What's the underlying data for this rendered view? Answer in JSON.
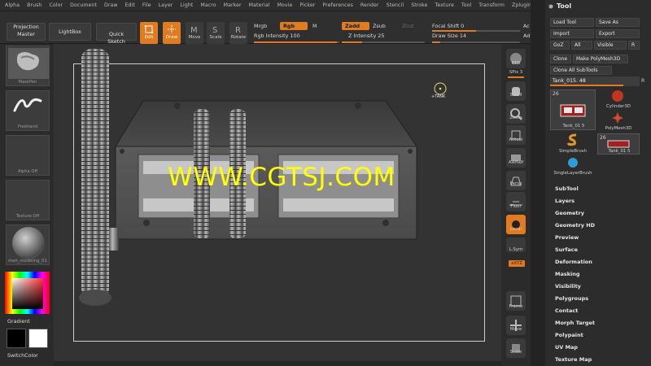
{
  "menu": [
    "Alpha",
    "Brush",
    "Color",
    "Document",
    "Draw",
    "Edit",
    "File",
    "Layer",
    "Light",
    "Macro",
    "Marker",
    "Material",
    "Movie",
    "Picker",
    "Preferences",
    "Render",
    "Stencil",
    "Stroke",
    "Texture",
    "Tool",
    "Transform",
    "Zplugin",
    "Zscript"
  ],
  "toolbar": {
    "projection_master": "Projection\nMaster",
    "lightbox": "LightBox",
    "quick_sketch": "Quick\nSketch",
    "edit": "Edit",
    "draw": "Draw",
    "move": "Move",
    "scale": "Scale",
    "rotate": "Rotate",
    "mrgb": "Mrgb",
    "rgb": "Rgb",
    "m": "M",
    "zadd": "Zadd",
    "zsub": "Zsub",
    "zcut": "Zcut",
    "rgb_intensity": "Rgb Intensity 100",
    "z_intensity": "Z Intensity 25",
    "focal_shift": "Focal Shift 0",
    "draw_size": "Draw Size 14",
    "ac": "Ac",
    "ad": "Ad"
  },
  "left": {
    "brush_label": "MaskPen",
    "stroke_label": "Freehand",
    "alpha_label": "Alpha Off",
    "texture_label": "Texture Off",
    "material_label": "mah_modeling_01",
    "gradient": "Gradient",
    "switchcolor": "SwitchColor"
  },
  "canvas": {
    "watermark": "WWW.CGTSJ.COM",
    "cursor_label": "+TANK"
  },
  "right": {
    "bpr": "BPR",
    "spix": "SPix 3",
    "scroll": "Scroll",
    "zoom": "Zoom",
    "actual": "Actual",
    "aahalf": "AAHalf",
    "persp": "Persp",
    "floor": "Floor",
    "local": "Local",
    "lsym": "L.Sym",
    "xyz": "xXYZ",
    "frame": "Frame",
    "move": "Move",
    "scale": "Scale"
  },
  "palette": {
    "title": "Tool",
    "load_tool": "Load Tool",
    "save_as": "Save As",
    "import": "Import",
    "export": "Export",
    "goz": "GoZ",
    "all": "All",
    "visible": "Visible",
    "r": "R",
    "clone": "Clone",
    "make_polymesh": "Make PolyMesh3D",
    "clone_all": "Clone All SubTools",
    "current_tool": "Tank_015. 48",
    "r2": "R",
    "thumb_count1": "26",
    "thumb_count2": "26",
    "tank_label1": "Tank_01 5",
    "cylinder": "Cylinder3D",
    "polymesh": "PolyMesh3D",
    "simplebrush": "SimpleBrush",
    "tank_label2": "Tank_01 5",
    "singlelayer": "SingleLayerBrush",
    "sections": [
      "SubTool",
      "Layers",
      "Geometry",
      "Geometry HD",
      "Preview",
      "Surface",
      "Deformation",
      "Masking",
      "Visibility",
      "Polygroups",
      "Contact",
      "Morph Target",
      "Polypaint",
      "UV Map",
      "Texture Map"
    ]
  },
  "colors": {
    "accent": "#e07b1f",
    "watermark": "#ffff00",
    "panel": "#2c2c2c"
  }
}
